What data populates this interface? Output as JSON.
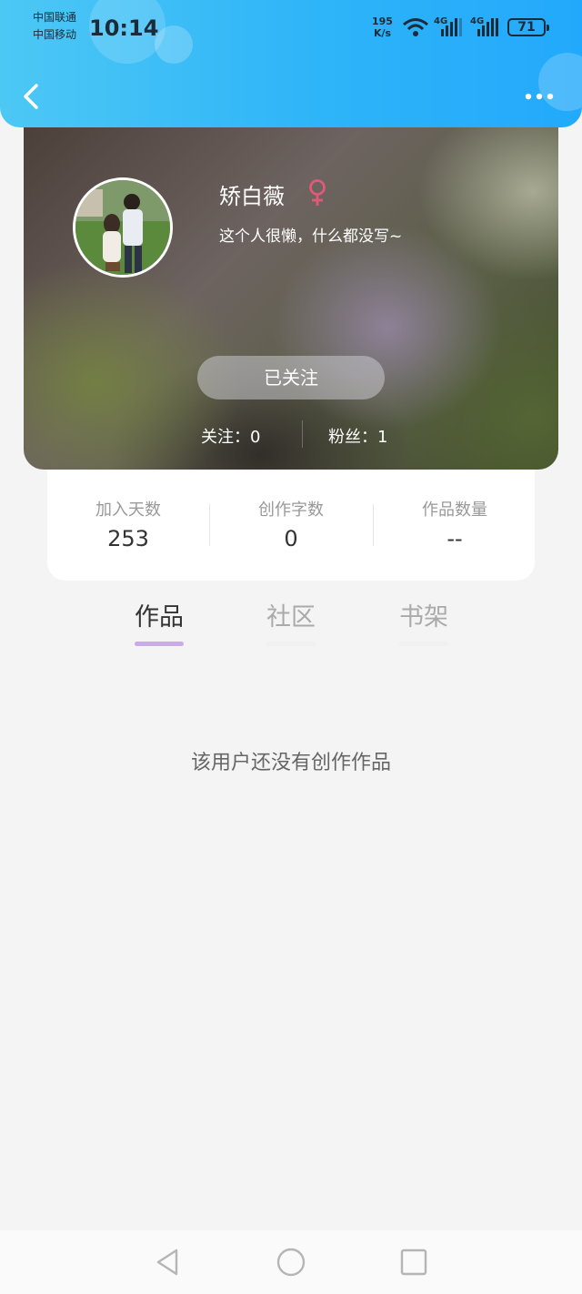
{
  "status_bar": {
    "carrier_1": "中国联通",
    "carrier_2": "中国移动",
    "time": "10:14",
    "speed_value": "195",
    "speed_unit": "K/s",
    "battery": "71"
  },
  "header": {
    "back_icon": "chevron-left-icon",
    "more_icon": "more-horizontal-icon"
  },
  "profile": {
    "name": "矫白薇",
    "gender_icon": "female-icon",
    "gender_color": "#e05a78",
    "bio": "这个人很懒，什么都没写~",
    "follow_button": "已关注",
    "following_text": "关注：0",
    "fans_text": "粉丝：1"
  },
  "stats": [
    {
      "label": "加入天数",
      "value": "253"
    },
    {
      "label": "创作字数",
      "value": "0"
    },
    {
      "label": "作品数量",
      "value": "--"
    }
  ],
  "tabs": [
    {
      "label": "作品",
      "active": true
    },
    {
      "label": "社区",
      "active": false
    },
    {
      "label": "书架",
      "active": false
    }
  ],
  "accent_color": "#c9aaea",
  "empty_message": "该用户还没有创作作品",
  "navbar": {
    "back_icon": "triangle-back-icon",
    "home_icon": "circle-home-icon",
    "recents_icon": "square-recents-icon"
  }
}
